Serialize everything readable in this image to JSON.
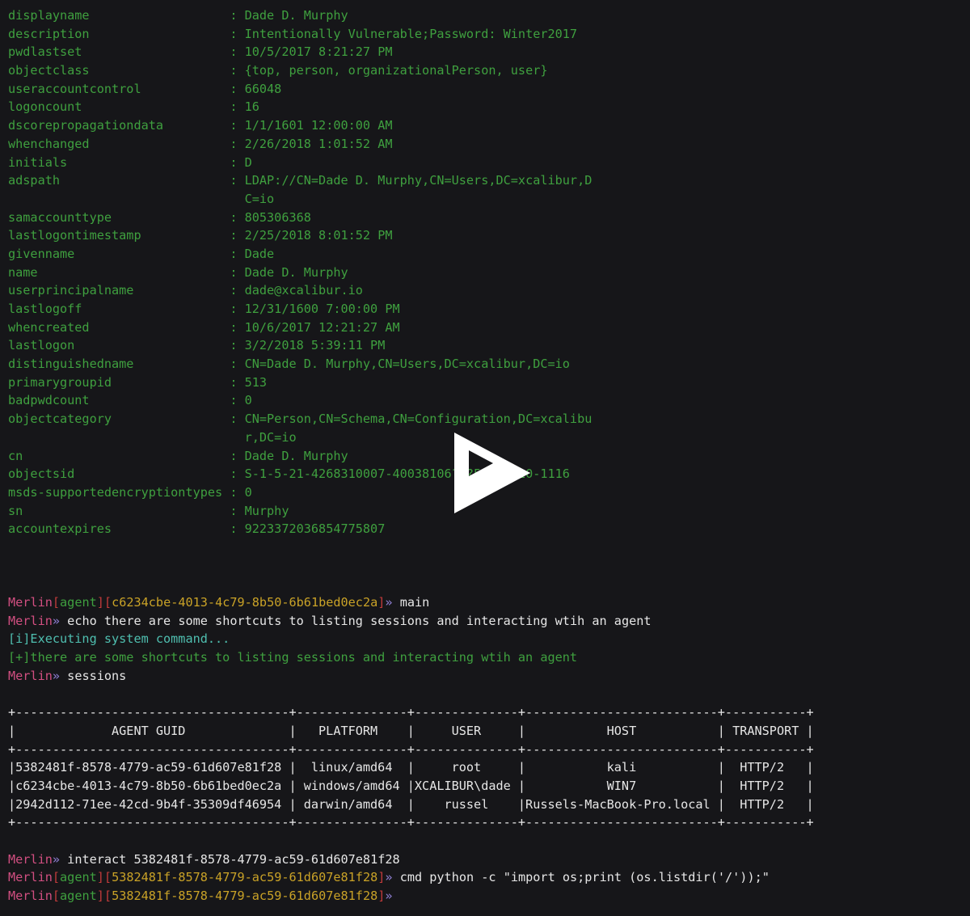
{
  "terminal": {
    "background_color": "#161619",
    "foreground_color": "#e6e6e6",
    "green_color": "#3fa03f",
    "prompt_name_color": "#d24f81",
    "bracket_color": "#c23b3b",
    "agent_word_color": "#3fa03f",
    "guid_color": "#c9a227",
    "chevron_color": "#8f7fd4",
    "info_color": "#4fbfb0"
  },
  "ldap_attributes": [
    {
      "key": "displayname",
      "value": "Dade D. Murphy"
    },
    {
      "key": "description",
      "value": "Intentionally Vulnerable;Password: Winter2017"
    },
    {
      "key": "pwdlastset",
      "value": "10/5/2017 8:21:27 PM"
    },
    {
      "key": "objectclass",
      "value": "{top, person, organizationalPerson, user}"
    },
    {
      "key": "useraccountcontrol",
      "value": "66048"
    },
    {
      "key": "logoncount",
      "value": "16"
    },
    {
      "key": "dscorepropagationdata",
      "value": "1/1/1601 12:00:00 AM"
    },
    {
      "key": "whenchanged",
      "value": "2/26/2018 1:01:52 AM"
    },
    {
      "key": "initials",
      "value": "D"
    },
    {
      "key": "adspath",
      "value": "LDAP://CN=Dade D. Murphy,CN=Users,DC=xcalibur,D",
      "continuation": "C=io"
    },
    {
      "key": "samaccounttype",
      "value": "805306368"
    },
    {
      "key": "lastlogontimestamp",
      "value": "2/25/2018 8:01:52 PM"
    },
    {
      "key": "givenname",
      "value": "Dade"
    },
    {
      "key": "name",
      "value": "Dade D. Murphy"
    },
    {
      "key": "userprincipalname",
      "value": "dade@xcalibur.io"
    },
    {
      "key": "lastlogoff",
      "value": "12/31/1600 7:00:00 PM"
    },
    {
      "key": "whencreated",
      "value": "10/6/2017 12:21:27 AM"
    },
    {
      "key": "lastlogon",
      "value": "3/2/2018 5:39:11 PM"
    },
    {
      "key": "distinguishedname",
      "value": "CN=Dade D. Murphy,CN=Users,DC=xcalibur,DC=io"
    },
    {
      "key": "primarygroupid",
      "value": "513"
    },
    {
      "key": "badpwdcount",
      "value": "0"
    },
    {
      "key": "objectcategory",
      "value": "CN=Person,CN=Schema,CN=Configuration,DC=xcalibu",
      "continuation": "r,DC=io"
    },
    {
      "key": "cn",
      "value": "Dade D. Murphy"
    },
    {
      "key": "objectsid",
      "value": "S-1-5-21-4268310007-40038106?-?52045410-1116"
    },
    {
      "key": "msds-supportedencryptiontypes",
      "value": "0"
    },
    {
      "key": "sn",
      "value": "Murphy"
    },
    {
      "key": "accountexpires",
      "value": "9223372036854775807"
    }
  ],
  "session_log": {
    "line1": {
      "prompt_name": "Merlin",
      "open_bracket": "[",
      "agent_word": "agent",
      "close_bracket": "]",
      "guid_open": "[",
      "guid": "c6234cbe-4013-4c79-8b50-6b61bed0ec2a",
      "guid_close": "]",
      "chevron": "»",
      "command": " main"
    },
    "line2": {
      "prompt_name": "Merlin",
      "chevron": "»",
      "command": " echo there are some shortcuts to listing sessions and interacting wtih an agent"
    },
    "line3": "[i]Executing system command...",
    "line4": "[+]there are some shortcuts to listing sessions and interacting wtih an agent",
    "line5": {
      "prompt_name": "Merlin",
      "chevron": "»",
      "command": " sessions"
    }
  },
  "sessions_table": {
    "border_top": "+-----------------------------------+---------------+--------------+--------------------------+-----------+",
    "border_mid": "+-----------------------------------+---------------+--------------+--------------------------+-----------+",
    "border_bottom": "+-----------------------------------+---------------+--------------+--------------------------+-----------+",
    "header_row": "|            AGENT GUID             |    PLATFORM   |     USER     |           HOST           | TRANSPORT |",
    "columns": [
      "AGENT GUID",
      "PLATFORM",
      "USER",
      "HOST",
      "TRANSPORT"
    ],
    "rows": [
      {
        "line": "| 5382481f-8578-4779-ac59-61d607e81f28 |  linux/amd64  |     root     |           kali           |  HTTP/2   |",
        "agent_guid": "5382481f-8578-4779-ac59-61d607e81f28",
        "platform": "linux/amd64",
        "user": "root",
        "host": "kali",
        "transport": "HTTP/2"
      },
      {
        "line": "| c6234cbe-4013-4c79-8b50-6b61bed0ec2a | windows/amd64 | XCALIBUR\\dade |           WIN7           |  HTTP/2   |",
        "agent_guid": "c6234cbe-4013-4c79-8b50-6b61bed0ec2a",
        "platform": "windows/amd64",
        "user": "XCALIBUR\\dade",
        "host": "WIN7",
        "transport": "HTTP/2"
      },
      {
        "line": "| 2942d112-71ee-42cd-9b4f-35309df46954 |  darwin/amd64 |    russel    | Russels-MacBook-Pro.local |  HTTP/2  |",
        "agent_guid": "2942d112-71ee-42cd-9b4f-35309df46954",
        "platform": "darwin/amd64",
        "user": "russel",
        "host": "Russels-MacBook-Pro.local",
        "transport": "HTTP/2"
      }
    ]
  },
  "bottom_log": {
    "interact_line": {
      "prompt_name": "Merlin",
      "chevron": "»",
      "command": " interact 5382481f-8578-4779-ac59-61d607e81f28"
    },
    "cmd_line": {
      "prompt_name": "Merlin",
      "open_bracket": "[",
      "agent_word": "agent",
      "close_bracket": "]",
      "guid_open": "[",
      "guid": "5382481f-8578-4779-ac59-61d607e81f28",
      "guid_close": "]",
      "chevron": "»",
      "command": " cmd python -c \"import os;print (os.listdir('/'));\""
    },
    "final_prompt": {
      "prompt_name": "Merlin",
      "open_bracket": "[",
      "agent_word": "agent",
      "close_bracket": "]",
      "guid_open": "[",
      "guid": "5382481f-8578-4779-ac59-61d607e81f28",
      "guid_close": "]",
      "chevron": "»",
      "command": ""
    }
  },
  "overlay": {
    "play_button_label": "play-button",
    "color": "#ffffff"
  }
}
